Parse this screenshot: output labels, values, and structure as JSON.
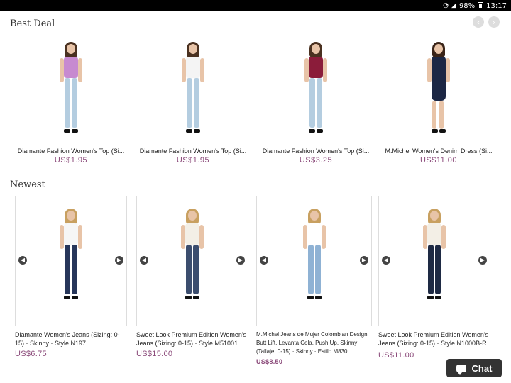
{
  "status_bar": {
    "battery": "98%",
    "time": "13:17"
  },
  "best_deal": {
    "title": "Best Deal",
    "nav": {
      "prev_glyph": "‹",
      "next_glyph": "›"
    },
    "items": [
      {
        "name": "Diamante Fashion Women's Top (Si...",
        "price": "US$1.95",
        "top_color": "#c78ad0",
        "bottom_color": "#b4cde0",
        "hair_color": "#4a3120"
      },
      {
        "name": "Diamante Fashion Women's Top (Si...",
        "price": "US$1.95",
        "top_color": "#f4f4f4",
        "bottom_color": "#b4cde0",
        "hair_color": "#4a3120"
      },
      {
        "name": "Diamante Fashion Women's Top (Si...",
        "price": "US$3.25",
        "top_color": "#8b1c3a",
        "bottom_color": "#b4cde0",
        "hair_color": "#4a3120"
      },
      {
        "name": "M.Michel Women's Denim Dress (Si...",
        "price": "US$11.00",
        "top_color": "#1c2744",
        "bottom_color": "#e8c4a8",
        "hair_color": "#3a2418"
      }
    ]
  },
  "newest": {
    "title": "Newest",
    "items": [
      {
        "name": "Diamante Women's Jeans (Sizing: 0-15) · Skinny · Style N197",
        "price": "US$6.75",
        "top_color": "#f6f6f6",
        "bottom_color": "#27365a",
        "hair_color": "#c8a060"
      },
      {
        "name": "Sweet Look Premium Edition Women's Jeans (Sizing: 0-15) · Style M51001",
        "price": "US$15.00",
        "top_color": "#f3efe6",
        "bottom_color": "#3b4d6e",
        "hair_color": "#c8a060"
      },
      {
        "name": "M.Michel Jeans de Mujer Colombian Design, Butt Lift, Levanta Cola, Push Up, Skinny (Tallaje: 0-15) · Skinny · Estilo M830",
        "price": "US$8.50",
        "top_color": "#ffffff",
        "bottom_color": "#8fb2d4",
        "hair_color": "#c8a060"
      },
      {
        "name": "Sweet Look Premium Edition Women's Jeans (Sizing: 0-15) · Style N1000B-R",
        "price": "US$11.00",
        "top_color": "#f3efe6",
        "bottom_color": "#1e2a44",
        "hair_color": "#c8a060"
      }
    ]
  },
  "chat": {
    "label": "Chat"
  },
  "colors": {
    "price": "#8b4a7a",
    "chat_bg": "#333333"
  }
}
